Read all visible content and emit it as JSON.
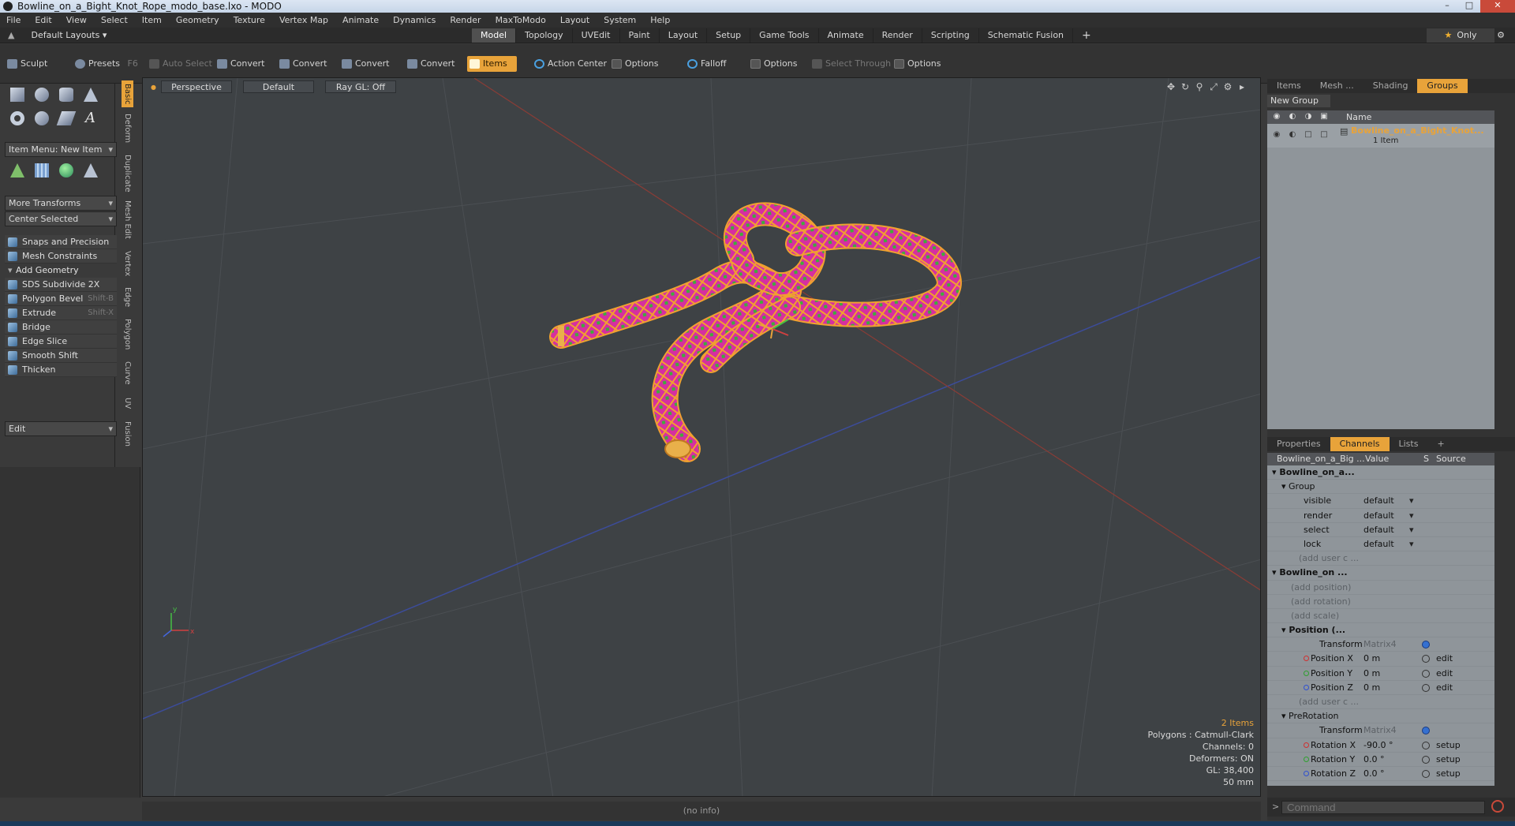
{
  "window": {
    "title": "Bowline_on_a_Bight_Knot_Rope_modo_base.lxo - MODO"
  },
  "menu": [
    "File",
    "Edit",
    "View",
    "Select",
    "Item",
    "Geometry",
    "Texture",
    "Vertex Map",
    "Animate",
    "Dynamics",
    "Render",
    "MaxToModo",
    "Layout",
    "System",
    "Help"
  ],
  "layoutbar": {
    "layouts_label": "Default Layouts",
    "tabs": [
      "Model",
      "Topology",
      "UVEdit",
      "Paint",
      "Layout",
      "Setup",
      "Game Tools",
      "Animate",
      "Render",
      "Scripting",
      "Schematic Fusion"
    ],
    "active_tab": "Model",
    "plus": "+",
    "only_label": "Only"
  },
  "toolbar": {
    "sculpt": "Sculpt",
    "presets": "Presets",
    "presets_shortcut": "F6",
    "auto_select": "Auto Select",
    "convert": "Convert",
    "items": "Items",
    "action_center": "Action Center",
    "options": "Options",
    "falloff": "Falloff",
    "select_through": "Select Through"
  },
  "leftpanel": {
    "item_menu": "Item Menu: New Item",
    "more_transforms": "More Transforms",
    "center_selected": "Center Selected",
    "snaps": "Snaps and Precision",
    "mesh_constraints": "Mesh Constraints",
    "add_geometry": "Add Geometry",
    "tools": [
      {
        "label": "SDS Subdivide 2X",
        "shortcut": ""
      },
      {
        "label": "Polygon Bevel",
        "shortcut": "Shift-B"
      },
      {
        "label": "Extrude",
        "shortcut": "Shift-X"
      },
      {
        "label": "Bridge",
        "shortcut": ""
      },
      {
        "label": "Edge Slice",
        "shortcut": ""
      },
      {
        "label": "Smooth Shift",
        "shortcut": ""
      },
      {
        "label": "Thicken",
        "shortcut": ""
      }
    ],
    "edit_dropdown": "Edit",
    "vtabs": [
      "Basic",
      "Deform",
      "Duplicate",
      "Mesh Edit",
      "Vertex",
      "Edge",
      "Polygon",
      "Curve",
      "UV",
      "Fusion"
    ]
  },
  "viewport": {
    "view": "Perspective",
    "shading": "Default",
    "raygl": "Ray GL: Off",
    "stats": {
      "items": "2 Items",
      "polygons": "Polygons : Catmull-Clark",
      "channels": "Channels: 0",
      "deformers": "Deformers: ON",
      "gl": "GL: 38,400",
      "focal": "50 mm"
    },
    "info": "(no info)"
  },
  "groups_panel": {
    "tabs": [
      "Items",
      "Mesh ...",
      "Shading",
      "Groups"
    ],
    "active_tab": "Groups",
    "new_group": "New Group",
    "col_name": "Name",
    "group_name": "Bowline_on_a_Bight_Knot...",
    "group_sub": "1 Item"
  },
  "channels_panel": {
    "tabs": [
      "Properties",
      "Channels",
      "Lists"
    ],
    "active_tab": "Channels",
    "plus": "+",
    "headers": {
      "name": "Bowline_on_a_Big ...",
      "value": "Value",
      "s": "S",
      "source": "Source"
    },
    "rows": [
      {
        "name": "Bowline_on_a...",
        "value": "",
        "source": ""
      },
      {
        "name": "Group",
        "value": "",
        "source": ""
      },
      {
        "name": "visible",
        "value": "default",
        "source": ""
      },
      {
        "name": "render",
        "value": "default",
        "source": ""
      },
      {
        "name": "select",
        "value": "default",
        "source": ""
      },
      {
        "name": "lock",
        "value": "default",
        "source": ""
      },
      {
        "name": "(add user c ...",
        "value": "",
        "source": ""
      },
      {
        "name": "Bowline_on ...",
        "value": "",
        "source": ""
      },
      {
        "name": "(add position)",
        "value": "",
        "source": ""
      },
      {
        "name": "(add rotation)",
        "value": "",
        "source": ""
      },
      {
        "name": "(add scale)",
        "value": "",
        "source": ""
      },
      {
        "name": "Position (...",
        "value": "",
        "source": ""
      },
      {
        "name": "Transform",
        "value": "Matrix4",
        "source": ""
      },
      {
        "name": "Position X",
        "value": "0 m",
        "source": "edit"
      },
      {
        "name": "Position Y",
        "value": "0 m",
        "source": "edit"
      },
      {
        "name": "Position Z",
        "value": "0 m",
        "source": "edit"
      },
      {
        "name": "(add user c ...",
        "value": "",
        "source": ""
      },
      {
        "name": "PreRotation",
        "value": "",
        "source": ""
      },
      {
        "name": "Transform",
        "value": "Matrix4",
        "source": ""
      },
      {
        "name": "Rotation X",
        "value": "-90.0 °",
        "source": "setup"
      },
      {
        "name": "Rotation Y",
        "value": "0.0 °",
        "source": "setup"
      },
      {
        "name": "Rotation Z",
        "value": "0.0 °",
        "source": "setup"
      }
    ],
    "command_placeholder": "Command"
  },
  "colors": {
    "accent": "#e8a33a",
    "rope": "#d62fa0",
    "rope_wire": "#f0a030",
    "rope_pattern": "#3fae3a"
  }
}
